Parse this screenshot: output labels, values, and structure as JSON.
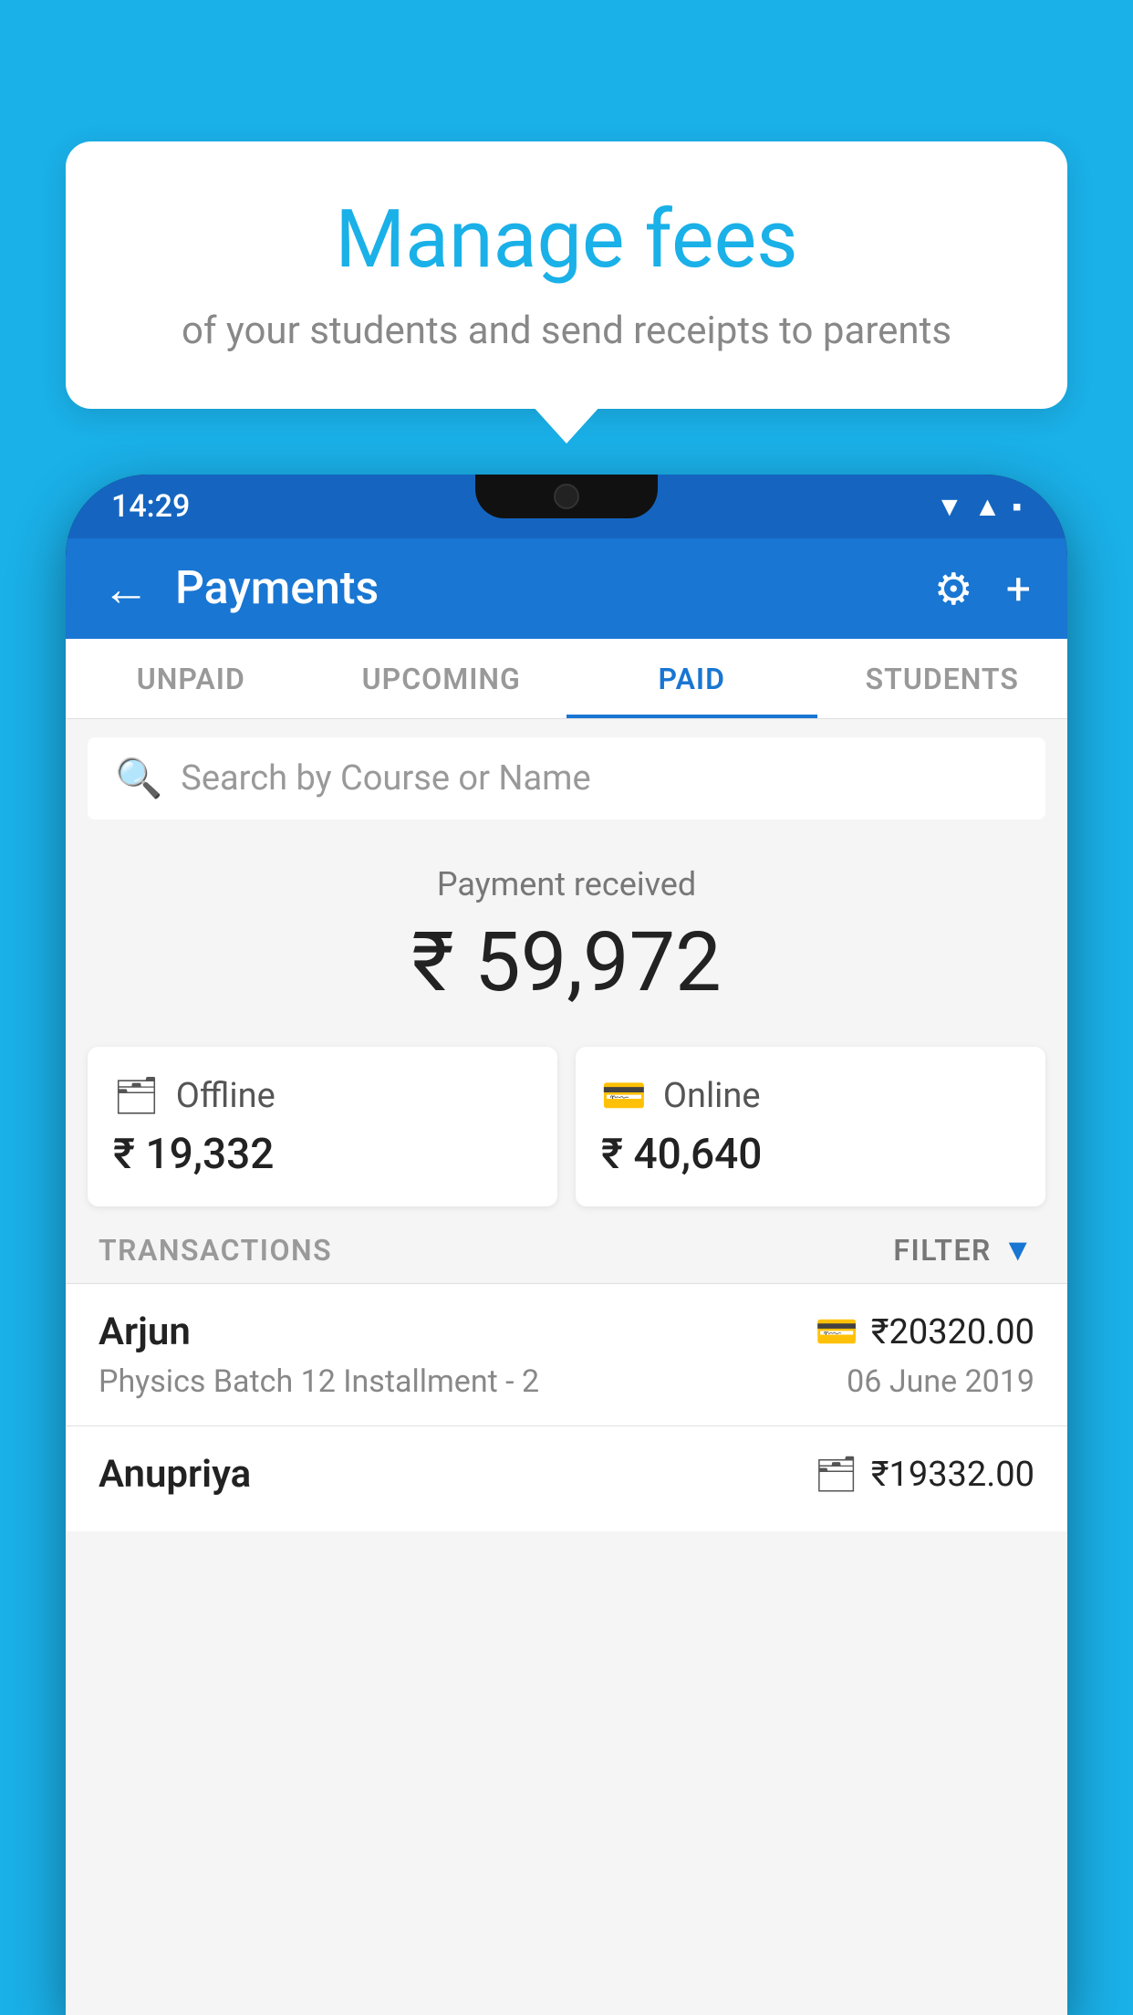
{
  "background_color": "#1ab0e8",
  "speech_bubble": {
    "title": "Manage fees",
    "subtitle": "of your students and send receipts to parents"
  },
  "phone": {
    "status_bar": {
      "time": "14:29",
      "icons": [
        "wifi",
        "signal",
        "battery"
      ]
    },
    "header": {
      "back_label": "←",
      "title": "Payments",
      "settings_icon": "⚙",
      "add_icon": "+"
    },
    "tabs": [
      {
        "label": "UNPAID",
        "active": false
      },
      {
        "label": "UPCOMING",
        "active": false
      },
      {
        "label": "PAID",
        "active": true
      },
      {
        "label": "STUDENTS",
        "active": false
      }
    ],
    "search": {
      "placeholder": "Search by Course or Name"
    },
    "payment_summary": {
      "label": "Payment received",
      "amount": "₹ 59,972"
    },
    "payment_cards": [
      {
        "type": "Offline",
        "amount": "₹ 19,332",
        "icon": "💳"
      },
      {
        "type": "Online",
        "amount": "₹ 40,640",
        "icon": "💳"
      }
    ],
    "transactions_section": {
      "label": "TRANSACTIONS",
      "filter_label": "FILTER",
      "items": [
        {
          "name": "Arjun",
          "course": "Physics Batch 12 Installment - 2",
          "amount": "₹20320.00",
          "date": "06 June 2019",
          "payment_type": "card"
        },
        {
          "name": "Anupriya",
          "course": "",
          "amount": "₹19332.00",
          "date": "",
          "payment_type": "cash"
        }
      ]
    }
  }
}
